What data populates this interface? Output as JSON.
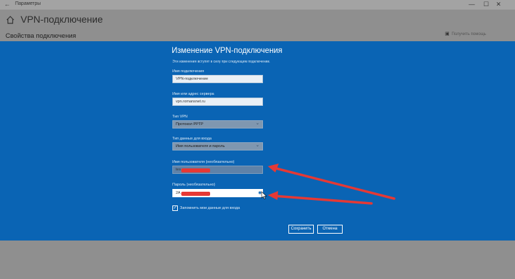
{
  "window": {
    "title": "Параметры",
    "back_icon": "back-arrow-icon",
    "minimize": "—",
    "maximize": "☐",
    "close": "✕"
  },
  "page": {
    "title": "VPN-подключение",
    "section": "Свойства подключения",
    "help_link": "Получить помощь"
  },
  "dialog": {
    "title": "Изменение VPN-подключения",
    "description": "Эти изменения вступят в силу при следующем подключении.",
    "fields": {
      "connection_name_label": "Имя подключения",
      "connection_name_value": "VPN-подключение",
      "server_label": "Имя или адрес сервера",
      "server_value": "vpn.romansnet.ru",
      "vpn_type_label": "Тип VPN",
      "vpn_type_value": "Протокол PPTP",
      "signin_type_label": "Тип данных для входа",
      "signin_type_value": "Имя пользователя и пароль",
      "username_label": "Имя пользователя (необязательно)",
      "username_value": "tes",
      "password_label": "Пароль (необязательно)",
      "password_value": "2A"
    },
    "remember_label": "Запомнить мои данные для входа",
    "remember_checked": "✓",
    "reveal_icon": "eye-icon",
    "save_label": "Сохранить",
    "cancel_label": "Отмена"
  },
  "colors": {
    "dialog_bg": "#0a64b4",
    "annotation": "#e53935",
    "dim_bg": "#8f8f8f"
  }
}
